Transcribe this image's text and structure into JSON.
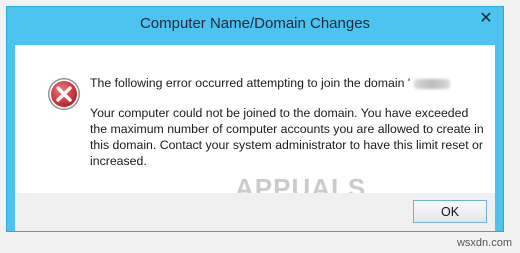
{
  "dialog": {
    "title": "Computer Name/Domain Changes",
    "close_label": "✕",
    "headline": "The following error occurred attempting to join the domain '",
    "body": "Your computer could not be joined to the domain. You have exceeded the maximum number of computer accounts you are allowed to create in this domain. Contact your system administrator to have this limit reset or increased.",
    "ok_label": "OK",
    "icon": "error-icon"
  },
  "watermarks": {
    "brand": "APPUALS",
    "site": "wsxdn.com"
  },
  "colors": {
    "frame": "#4dc3f0",
    "error_red": "#c8323a",
    "button_border": "#6fb0dc"
  }
}
